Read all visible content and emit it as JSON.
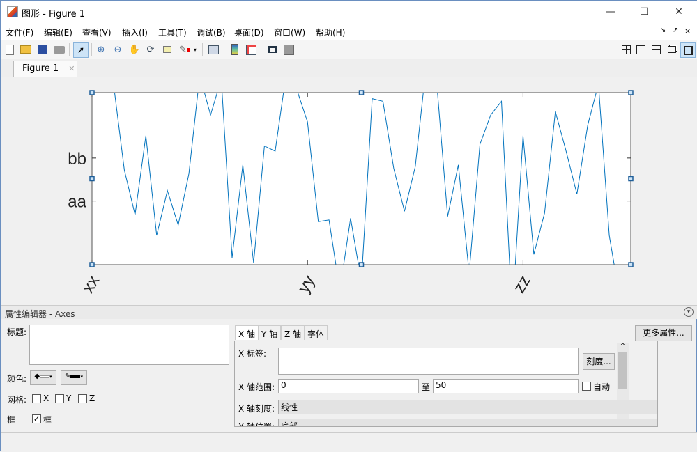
{
  "window": {
    "title": "图形 - Figure 1",
    "minimize": "—",
    "maximize": "☐",
    "close": "✕"
  },
  "menu": [
    "文件(F)",
    "编辑(E)",
    "查看(V)",
    "插入(I)",
    "工具(T)",
    "调试(B)",
    "桌面(D)",
    "窗口(W)",
    "帮助(H)"
  ],
  "menu_right": [
    "↘",
    "↗",
    "×"
  ],
  "toolbar_icons": [
    "new-file",
    "open-folder",
    "save",
    "print",
    "edit-plot-pointer",
    "zoom-in",
    "zoom-out",
    "pan",
    "rotate-3d",
    "data-cursor",
    "brush",
    "brush-dropdown",
    "link-plot",
    "colorbar",
    "legend",
    "hide-plot-tools",
    "show-plot-tools"
  ],
  "layout_icons": [
    "grid-2x2",
    "split-columns",
    "split-rows",
    "float",
    "dock"
  ],
  "tab": {
    "label": "Figure 1",
    "close": "✕"
  },
  "colors": {
    "line": "#0072bd",
    "handle": "#1f5f99",
    "accent": "#cde4f7"
  },
  "chart_data": {
    "type": "line",
    "x": [
      0,
      1,
      2,
      3,
      4,
      5,
      6,
      7,
      8,
      9,
      10,
      11,
      12,
      13,
      14,
      15,
      16,
      17,
      18,
      19,
      20,
      21,
      22,
      23,
      24,
      25,
      26,
      27,
      28,
      29,
      30,
      31,
      32,
      33,
      34,
      35,
      36,
      37,
      38,
      39,
      40,
      41,
      42,
      43,
      44,
      45,
      46,
      47,
      48,
      49,
      50
    ],
    "y": [
      1.2,
      1.1,
      1.05,
      0.55,
      0.29,
      0.75,
      0.17,
      0.43,
      0.23,
      0.53,
      1.1,
      0.87,
      1.08,
      0.04,
      0.58,
      0.01,
      0.69,
      0.66,
      1.1,
      1.02,
      0.83,
      0.25,
      0.26,
      -0.15,
      0.27,
      -0.1,
      0.965,
      0.95,
      0.56,
      0.31,
      0.57,
      1.15,
      1.05,
      0.28,
      0.58,
      -0.05,
      0.7,
      0.87,
      0.95,
      -0.3,
      0.75,
      0.06,
      0.3,
      0.89,
      0.66,
      0.41,
      0.81,
      1.05,
      0.17,
      -0.2,
      -0.4
    ],
    "xlim": [
      0,
      50
    ],
    "ylim": [
      0,
      1
    ],
    "xticks": [
      {
        "value": 0,
        "label": "xx"
      },
      {
        "value": 20,
        "label": "yy"
      },
      {
        "value": 40,
        "label": "zz"
      }
    ],
    "yticks": [
      {
        "value": 0.37,
        "label": "aa"
      },
      {
        "value": 0.62,
        "label": "bb"
      }
    ],
    "grid": false
  },
  "prop_editor": {
    "header": "属性编辑器 - Axes",
    "collapse": "▾",
    "title_label": "标题:",
    "title_value": "",
    "color_label": "颜色:",
    "grid_label": "网格:",
    "grid": [
      {
        "label": "X",
        "checked": false
      },
      {
        "label": "Y",
        "checked": false
      },
      {
        "label": "Z",
        "checked": false
      }
    ],
    "box_label": "框",
    "box_check_label": "框",
    "box_checked": true,
    "tabs": [
      "X 轴",
      "Y 轴",
      "Z 轴",
      "字体"
    ],
    "more_props": "更多属性...",
    "xlabel_label": "X 标签:",
    "xlabel_value": "",
    "ticks_btn": "刻度...",
    "xrange_label": "X 轴范围:",
    "xmin": "0",
    "to": "至",
    "xmax": "50",
    "auto_label": "自动",
    "xscale_label": "X 轴刻度:",
    "xscale_value": "线性",
    "xloc_label": "X 轴位置:",
    "xloc_value": "底部",
    "scroll_up": "^"
  }
}
